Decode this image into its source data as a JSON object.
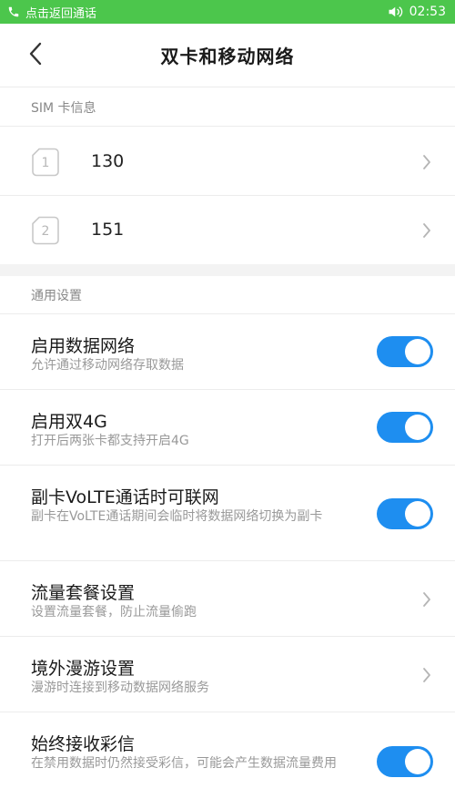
{
  "status_bar": {
    "call_text": "点击返回通话",
    "time": "02:53",
    "bg_color": "#4cc64c"
  },
  "header": {
    "title": "双卡和移动网络"
  },
  "sim_section": {
    "header": "SIM 卡信息",
    "cards": [
      {
        "slot": "1",
        "number": "130"
      },
      {
        "slot": "2",
        "number": "151"
      }
    ]
  },
  "general_section": {
    "header": "通用设置",
    "items": [
      {
        "title": "启用数据网络",
        "desc": "允许通过移动网络存取数据",
        "control": "toggle",
        "on": true
      },
      {
        "title": "启用双4G",
        "desc": "打开后两张卡都支持开启4G",
        "control": "toggle",
        "on": true
      },
      {
        "title": "副卡VoLTE通话时可联网",
        "desc": "副卡在VoLTE通话期间会临时将数据网络切换为副卡",
        "control": "toggle",
        "on": true
      },
      {
        "title": "流量套餐设置",
        "desc": "设置流量套餐，防止流量偷跑",
        "control": "chevron"
      },
      {
        "title": "境外漫游设置",
        "desc": "漫游时连接到移动数据网络服务",
        "control": "chevron"
      },
      {
        "title": "始终接收彩信",
        "desc": "在禁用数据时仍然接受彩信，可能会产生数据流量费用",
        "control": "toggle",
        "on": true
      }
    ]
  },
  "colors": {
    "toggle_on": "#1e8ef0",
    "divider": "#ececec",
    "secondary_text": "#999999"
  }
}
